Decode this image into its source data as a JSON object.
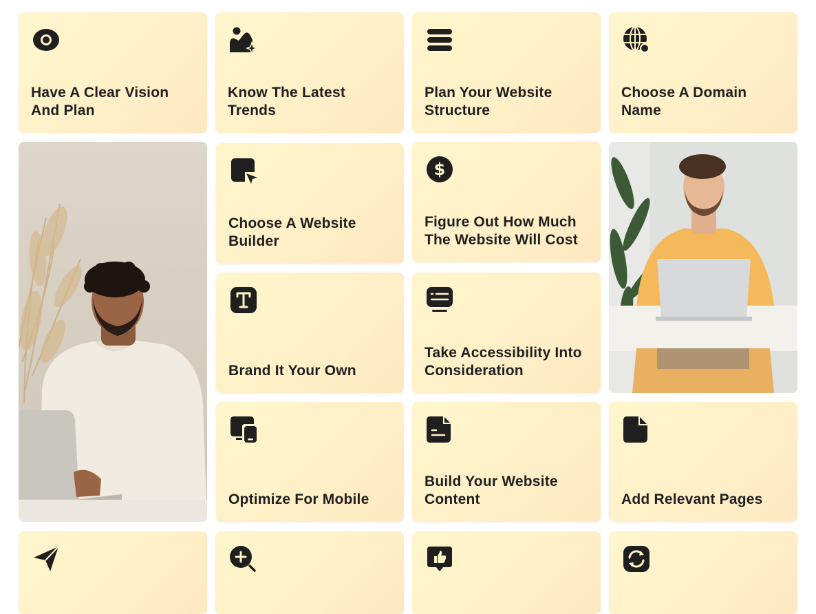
{
  "cards": [
    {
      "id": "vision",
      "icon": "eye-icon",
      "label": "Have A Clear Vision And Plan"
    },
    {
      "id": "trends",
      "icon": "image-sparkle-icon",
      "label": "Know The Latest Trends"
    },
    {
      "id": "structure",
      "icon": "layers-stack-icon",
      "label": "Plan Your Website Structure"
    },
    {
      "id": "domain",
      "icon": "globe-search-icon",
      "label": "Choose A Domain Name"
    },
    {
      "id": "builder",
      "icon": "cursor-click-icon",
      "label": "Choose A Website Builder"
    },
    {
      "id": "cost",
      "icon": "dollar-coin-icon",
      "label": "Figure Out How Much The Website Will Cost"
    },
    {
      "id": "brand",
      "icon": "text-type-icon",
      "label": "Brand It Your Own"
    },
    {
      "id": "accessibility",
      "icon": "chat-screen-icon",
      "label": "Take Accessibility Into Consideration"
    },
    {
      "id": "mobile",
      "icon": "devices-icon",
      "label": "Optimize For Mobile"
    },
    {
      "id": "content",
      "icon": "document-text-icon",
      "label": "Build Your Website Content"
    },
    {
      "id": "pages",
      "icon": "file-icon",
      "label": "Add Relevant Pages"
    },
    {
      "id": "launch",
      "icon": "paper-plane-icon",
      "label": ""
    },
    {
      "id": "seo",
      "icon": "zoom-plus-icon",
      "label": ""
    },
    {
      "id": "feedback",
      "icon": "thumbs-up-badge-icon",
      "label": ""
    },
    {
      "id": "update",
      "icon": "refresh-icon",
      "label": ""
    }
  ],
  "theme": {
    "card_bg": "#fff3c9",
    "icon_color": "#1f1f1f",
    "text_color": "#1f1f1f"
  }
}
